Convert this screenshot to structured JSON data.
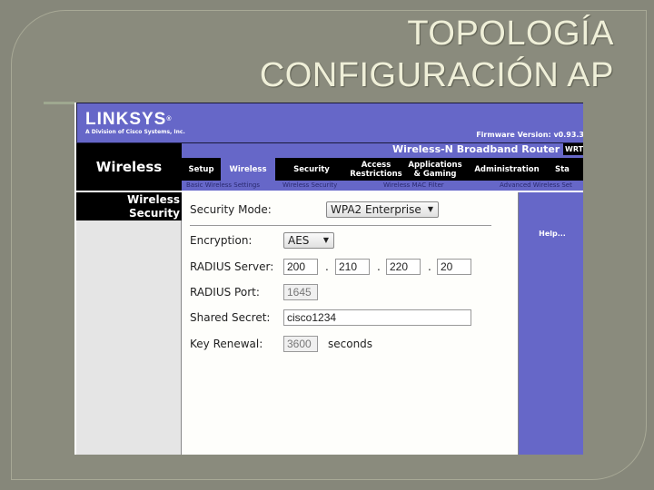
{
  "slide": {
    "title_line1": "TOPOLOGÍA",
    "title_line2": "CONFIGURACIÓN AP"
  },
  "router": {
    "brand": "LINKSYS",
    "brand_trademark": "®",
    "brand_subtitle": "A Division of Cisco Systems, Inc.",
    "firmware": "Firmware Version: v0.93.3",
    "product_name": "Wireless-N Broadband Router",
    "model": "WRT",
    "section": "Wireless",
    "tabs": [
      {
        "label": "Setup",
        "active": false
      },
      {
        "label": "Wireless",
        "active": true
      },
      {
        "label": "Security",
        "active": false
      },
      {
        "label": "Access Restrictions",
        "active": false
      },
      {
        "label": "Applications & Gaming",
        "active": false
      },
      {
        "label": "Administration",
        "active": false
      },
      {
        "label": "Sta",
        "active": false
      }
    ],
    "subtabs": [
      "Basic Wireless Settings",
      "Wireless Security",
      "Wireless MAC Filter",
      "Advanced Wireless Set"
    ],
    "sidebar_label_line1": "Wireless",
    "sidebar_label_line2": "Security",
    "help_link": "Help..."
  },
  "form": {
    "security_mode": {
      "label": "Security Mode:",
      "value": "WPA2 Enterprise"
    },
    "encryption": {
      "label": "Encryption:",
      "value": "AES"
    },
    "radius_server": {
      "label": "RADIUS Server:",
      "octets": [
        "200",
        "210",
        "220",
        "20"
      ],
      "separator": "."
    },
    "radius_port": {
      "label": "RADIUS Port:",
      "value": "1645"
    },
    "shared_secret": {
      "label": "Shared Secret:",
      "value": "cisco1234"
    },
    "key_renewal": {
      "label": "Key Renewal:",
      "value": "3600",
      "unit": "seconds"
    }
  },
  "colors": {
    "linksys_purple": "#6667c8",
    "slide_background": "#86877a",
    "title_text": "#efefd8"
  }
}
